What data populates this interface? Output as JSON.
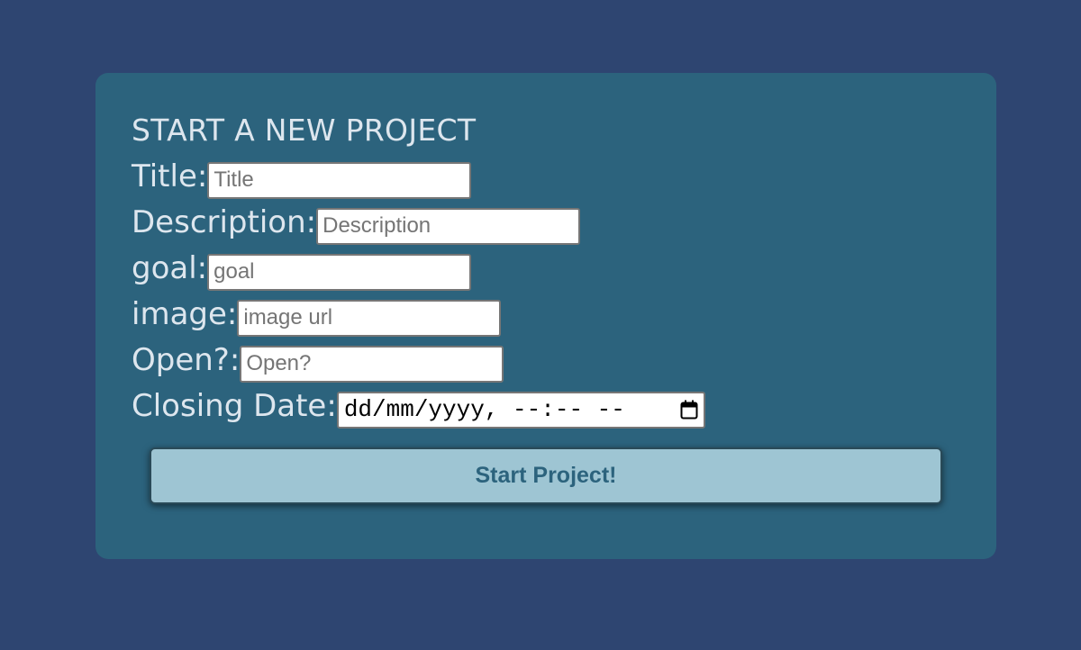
{
  "form": {
    "heading": "START A NEW PROJECT",
    "fields": [
      {
        "label": "Title:",
        "placeholder": "Title",
        "value": ""
      },
      {
        "label": "Description:",
        "placeholder": "Description",
        "value": ""
      },
      {
        "label": "goal:",
        "placeholder": "goal",
        "value": ""
      },
      {
        "label": "image:",
        "placeholder": "image url",
        "value": ""
      },
      {
        "label": "Open?:",
        "placeholder": "Open?",
        "value": ""
      }
    ],
    "closing_date": {
      "label": "Closing Date:",
      "display": "dd/mm/yyyy, --:-- --"
    },
    "submit_label": "Start Project!"
  },
  "colors": {
    "page_background": "#2e4571",
    "card_background": "#2c637d",
    "label_text": "#dde6ee",
    "button_background": "#9ec5d3",
    "button_text": "#2c637d"
  },
  "icons": {
    "date_picker": "calendar-icon"
  }
}
